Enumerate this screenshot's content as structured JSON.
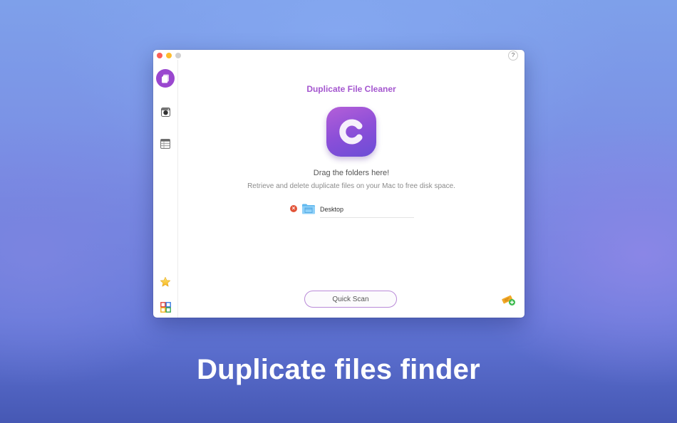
{
  "window": {
    "help_label": "?",
    "sidebar": {
      "items": [
        {
          "icon": "duplicate-files-icon",
          "active": true
        },
        {
          "icon": "photo-camera-icon",
          "active": false
        },
        {
          "icon": "file-list-icon",
          "active": false
        }
      ],
      "bottom_items": [
        {
          "icon": "star-icon"
        },
        {
          "icon": "more-apps-icon"
        }
      ]
    },
    "main": {
      "title": "Duplicate File Cleaner",
      "logo_letter": "C",
      "drag_text": "Drag the folders here!",
      "sub_text": "Retrieve and delete duplicate files on your Mac to free disk space.",
      "folders": [
        {
          "name": "Desktop"
        }
      ],
      "remove_glyph": "×",
      "quick_scan_label": "Quick Scan"
    }
  },
  "caption": "Duplicate files finder",
  "colors": {
    "accent": "#9a47cf",
    "title": "#a456cf",
    "remove": "#e25439"
  }
}
